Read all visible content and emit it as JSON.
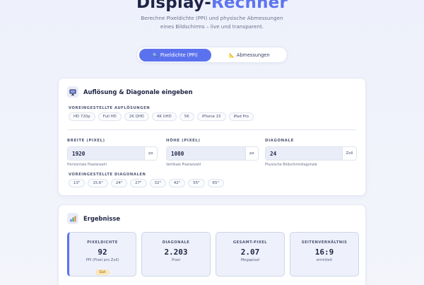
{
  "hero": {
    "title_main": "Display-",
    "title_accent": "Rechner",
    "subtitle": "Berechne Pixeldichte (PPI) und physische Abmessungen eines Bildschirms – live und transparent."
  },
  "tabs": [
    {
      "icon": "🔍",
      "label": "Pixeldichte (PPI)",
      "active": true
    },
    {
      "icon": "📐",
      "label": "Abmessungen",
      "active": false
    }
  ],
  "input_card": {
    "title": "Auflösung & Diagonale eingeben",
    "preset_resolutions_label": "VOREINGESTELLTE AUFLÖSUNGEN",
    "preset_resolutions": [
      "HD 720p",
      "Full HD",
      "2K QHD",
      "4K UHD",
      "5K",
      "iPhone 15",
      "iPad Pro"
    ],
    "width": {
      "label": "BREITE (PIXEL)",
      "value": "1920",
      "unit": "px",
      "hint": "Horizontale Pixelanzahl"
    },
    "height": {
      "label": "HÖHE (PIXEL)",
      "value": "1080",
      "unit": "px",
      "hint": "Vertikale Pixelanzahl"
    },
    "diagonal": {
      "label": "DIAGONALE",
      "value": "24",
      "unit": "Zoll",
      "hint": "Physische Bildschirmdiagonale"
    },
    "preset_diagonals_label": "VOREINGESTELLTE DIAGONALEN",
    "preset_diagonals": [
      "13\"",
      "15.6\"",
      "24\"",
      "27\"",
      "32\"",
      "42\"",
      "55\"",
      "65\""
    ]
  },
  "results_card": {
    "title": "Ergebnisse",
    "stats": [
      {
        "label": "PIXELDICHTE",
        "value": "92",
        "sub": "PPI (Pixel pro Zoll)",
        "badge": "Gut"
      },
      {
        "label": "DIAGONALE",
        "value": "2.203",
        "sub": "Pixel"
      },
      {
        "label": "GESAMT-PIXEL",
        "value": "2.07",
        "sub": "Megapixel"
      },
      {
        "label": "SEITENVERHÄLTNIS",
        "value": "16:9",
        "sub": "ermittelt"
      }
    ]
  },
  "colors": {
    "accent": "#5b72ef",
    "badge_bg": "#fbe7b8"
  }
}
